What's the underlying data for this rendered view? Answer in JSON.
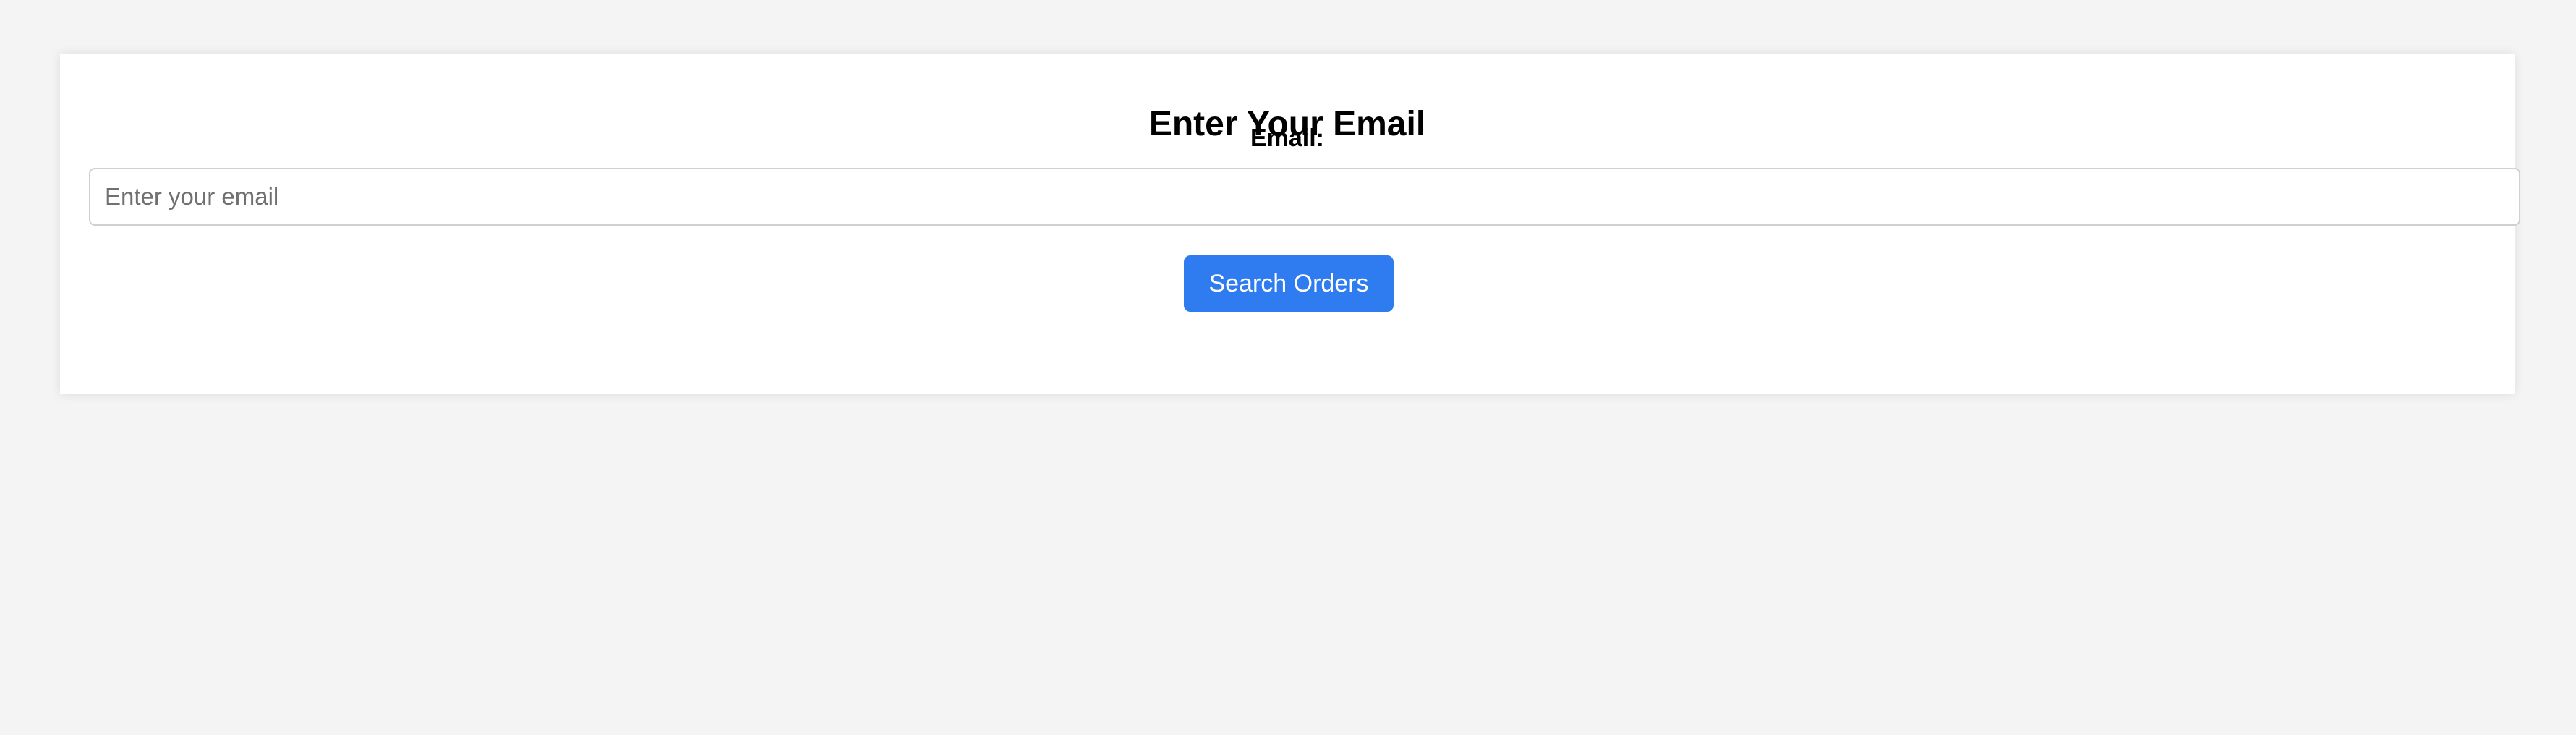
{
  "form": {
    "title": "Enter Your Email",
    "email_label": "Email:",
    "email_placeholder": "Enter your email",
    "email_value": "",
    "submit_label": "Search Orders"
  },
  "colors": {
    "page_background": "#f4f4f4",
    "card_background": "#ffffff",
    "button_background": "#2f7cf0",
    "button_text": "#ffffff",
    "input_border": "#d0d0d0"
  }
}
